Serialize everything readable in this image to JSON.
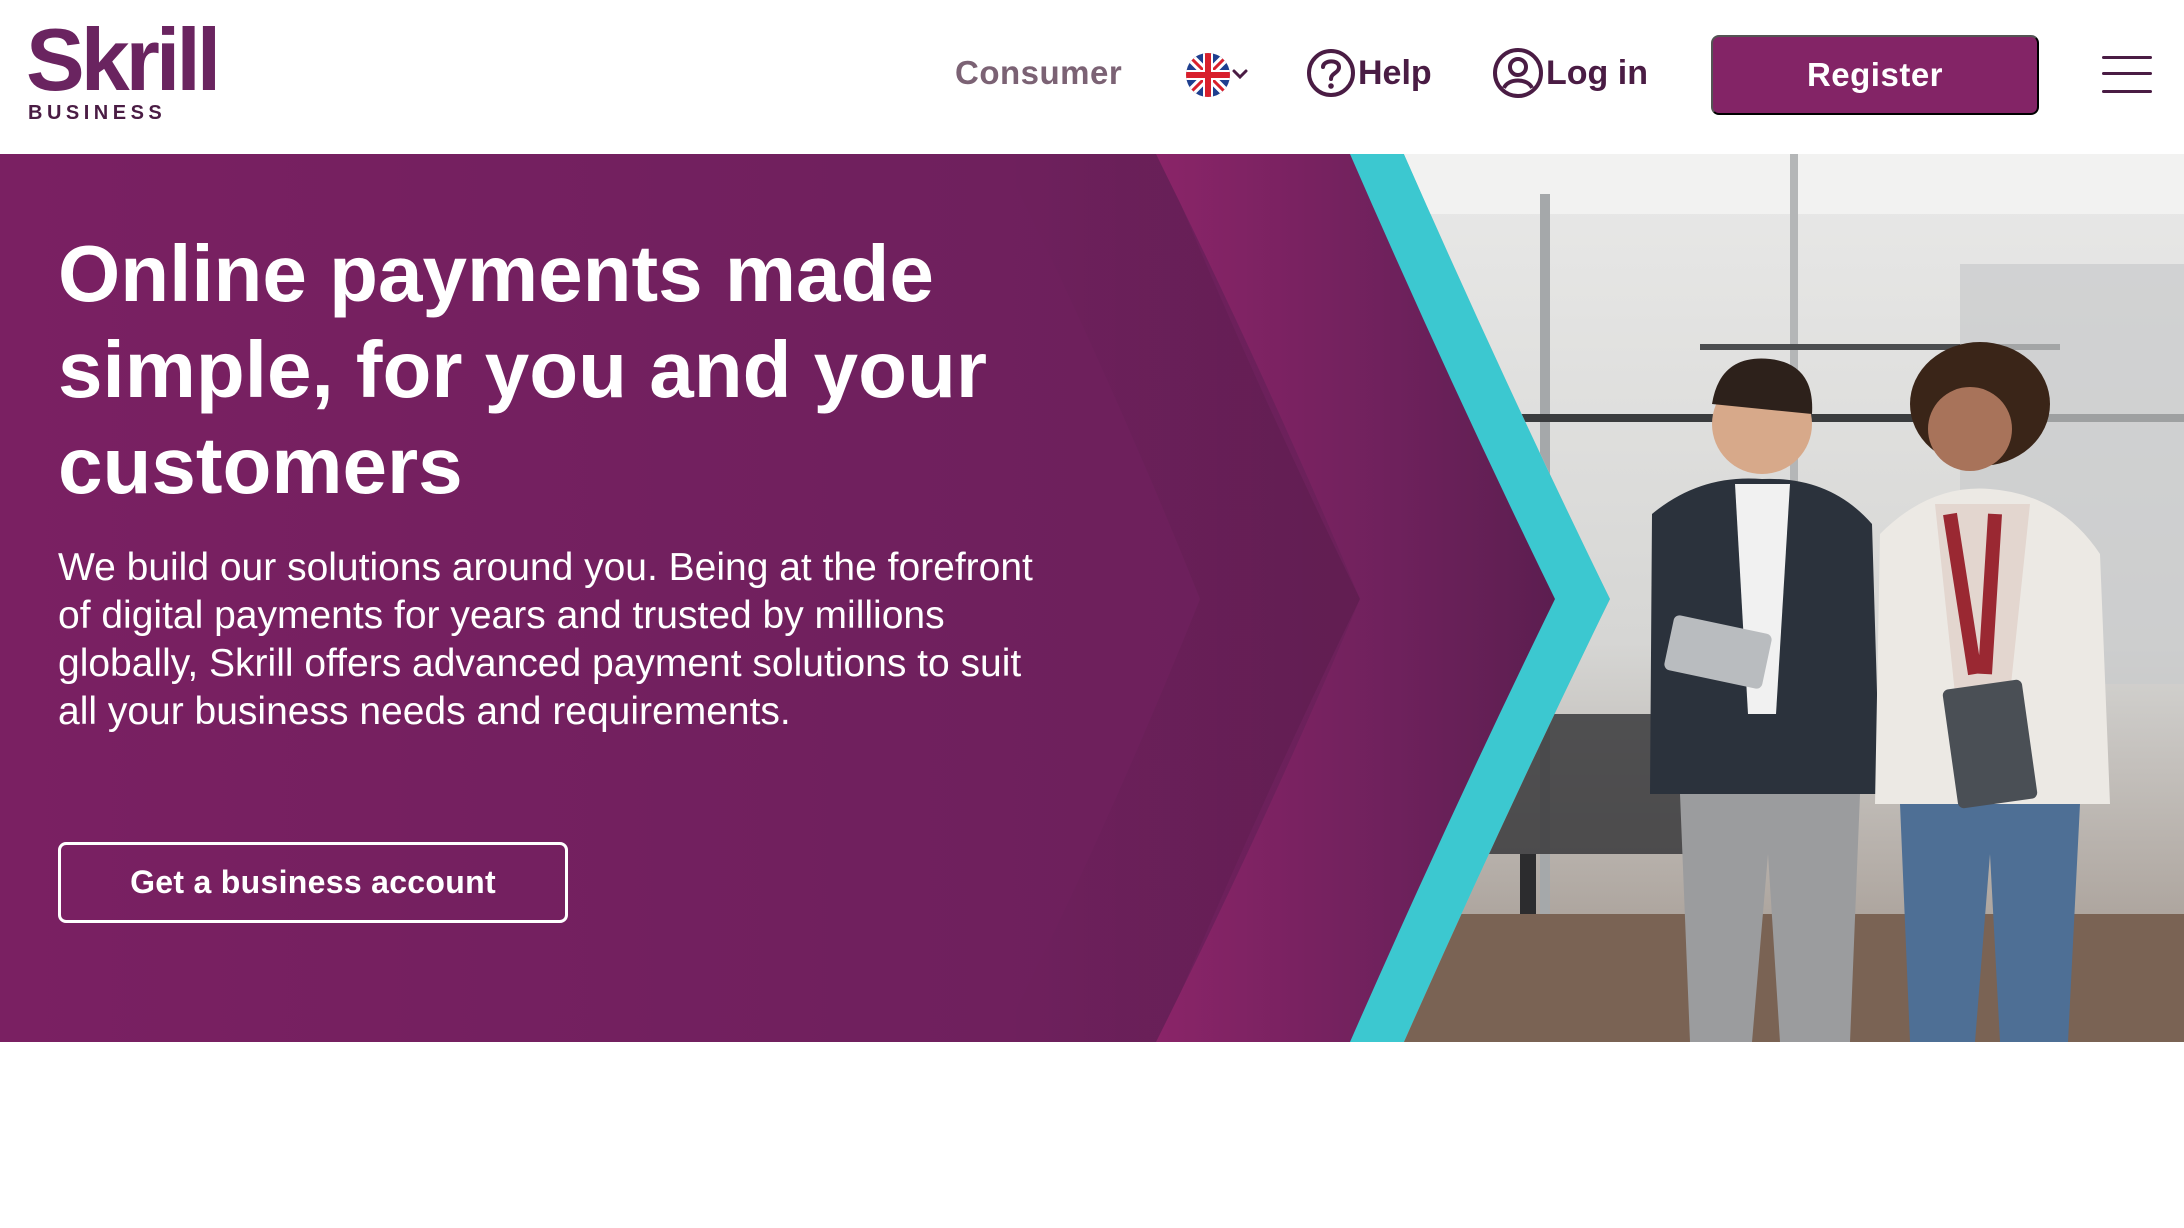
{
  "brand": {
    "name": "Skrill",
    "sub": "BUSINESS",
    "color": "#832466"
  },
  "nav": {
    "consumer_label": "Consumer",
    "language_icon": "uk-flag-icon",
    "help_label": "Help",
    "login_label": "Log in",
    "register_label": "Register",
    "menu_icon": "hamburger-menu-icon"
  },
  "hero": {
    "title": "Online payments made simple, for you and your customers",
    "description": "We build our solutions around you. Being at the forefront of digital payments for years and trusted by millions globally, Skrill offers advanced payment solutions to suit all your business needs and requirements.",
    "cta_label": "Get a business account",
    "colors": {
      "background": "#70205e",
      "accent": "#3cc8d0",
      "chevron": "#8a2468"
    }
  }
}
